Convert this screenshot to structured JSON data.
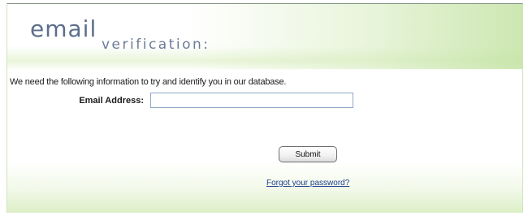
{
  "header": {
    "title_main": "email",
    "title_sub": "verification:"
  },
  "form": {
    "intro_text": "We need the following information to try and identify you in our database.",
    "email_label": "Email Address:",
    "email_value": "",
    "submit_label": "Submit",
    "forgot_link": "Forgot your password?"
  },
  "colors": {
    "title": "#5c6e8c",
    "accent_green": "#c4e3a4",
    "link": "#1f3f8f",
    "input_border": "#8fa7c6"
  }
}
